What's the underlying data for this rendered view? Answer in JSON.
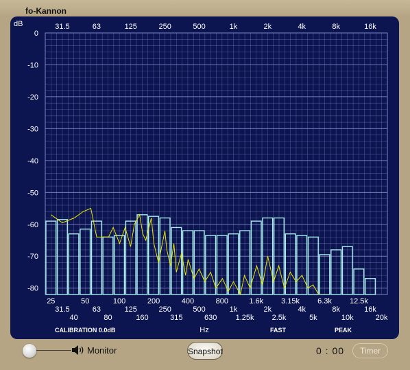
{
  "window": {
    "title": "fo-Kannon"
  },
  "analyzer": {
    "unit": "dB",
    "top_labels": [
      "31.5",
      "63",
      "125",
      "250",
      "500",
      "1k",
      "2k",
      "4k",
      "8k",
      "16k"
    ],
    "db_labels": [
      "0",
      "-10",
      "-20",
      "-30",
      "-40",
      "-50",
      "-60",
      "-70",
      "-80"
    ],
    "band_labels_row1": [
      "25",
      "50",
      "100",
      "200",
      "400",
      "800",
      "1.6k",
      "3.15k",
      "6.3k",
      "12.5k"
    ],
    "band_labels_row2": [
      "31.5",
      "63",
      "125",
      "250",
      "500",
      "1k",
      "2k",
      "4k",
      "8k",
      "16k"
    ],
    "band_labels_row3": [
      "40",
      "80",
      "160",
      "315",
      "630",
      "1.25k",
      "2.5k",
      "5k",
      "10k",
      "20k"
    ],
    "hz_label": "Hz",
    "calibration": "CALIBRATION 0.0dB",
    "response": "FAST",
    "detector": "PEAK"
  },
  "chart_data": {
    "type": "bar",
    "title": "",
    "xlabel": "Hz",
    "ylabel": "dB",
    "ylim": [
      -82,
      0
    ],
    "categories": [
      "25",
      "31.5",
      "40",
      "50",
      "63",
      "80",
      "100",
      "125",
      "160",
      "200",
      "250",
      "315",
      "400",
      "500",
      "630",
      "800",
      "1k",
      "1.25k",
      "1.6k",
      "2k",
      "2.5k",
      "3.15k",
      "4k",
      "5k",
      "6.3k",
      "8k",
      "10k",
      "12.5k",
      "16k",
      "20k"
    ],
    "series": [
      {
        "values": [
          -59,
          -58.5,
          -63,
          -61.5,
          -59,
          -64,
          -63.5,
          -59,
          -57,
          -57.5,
          -58,
          -61,
          -62,
          -62,
          -63.5,
          -63.5,
          -63,
          -62,
          -59,
          -58,
          -58,
          -63,
          -63.5,
          -64,
          -69.5,
          -68,
          -67,
          -74,
          -77,
          -82
        ]
      }
    ],
    "line_trace": [
      [
        25,
        -57
      ],
      [
        31.5,
        -59.5
      ],
      [
        40,
        -58
      ],
      [
        48,
        -56
      ],
      [
        56,
        -55
      ],
      [
        63,
        -64
      ],
      [
        80,
        -64
      ],
      [
        88,
        -61
      ],
      [
        100,
        -66
      ],
      [
        112,
        -61
      ],
      [
        125,
        -67
      ],
      [
        135,
        -60
      ],
      [
        150,
        -57
      ],
      [
        160,
        -63
      ],
      [
        170,
        -65
      ],
      [
        190,
        -58
      ],
      [
        200,
        -66
      ],
      [
        220,
        -72
      ],
      [
        250,
        -62
      ],
      [
        260,
        -68
      ],
      [
        280,
        -73
      ],
      [
        300,
        -66
      ],
      [
        315,
        -75
      ],
      [
        350,
        -69
      ],
      [
        380,
        -76
      ],
      [
        400,
        -71
      ],
      [
        450,
        -77
      ],
      [
        500,
        -74
      ],
      [
        560,
        -78
      ],
      [
        630,
        -75
      ],
      [
        700,
        -80
      ],
      [
        800,
        -77
      ],
      [
        900,
        -81
      ],
      [
        1000,
        -78
      ],
      [
        1150,
        -82
      ],
      [
        1250,
        -76
      ],
      [
        1400,
        -80
      ],
      [
        1600,
        -73
      ],
      [
        1800,
        -79
      ],
      [
        2000,
        -70
      ],
      [
        2250,
        -78
      ],
      [
        2500,
        -73
      ],
      [
        2800,
        -80
      ],
      [
        3150,
        -75
      ],
      [
        3550,
        -78
      ],
      [
        4000,
        -76
      ],
      [
        4500,
        -80
      ],
      [
        5000,
        -79
      ],
      [
        5600,
        -82
      ]
    ]
  },
  "controls": {
    "monitor_label": "Monitor",
    "snapshot_label": "Snapshot",
    "timer_value": "0 : 00",
    "timer_label": "Timer"
  },
  "colors": {
    "panel": "#0c1550",
    "grid": "#7d86c4",
    "bars": "#a9ecec",
    "trace": "#e6e600",
    "chrome": "#b5a584"
  }
}
